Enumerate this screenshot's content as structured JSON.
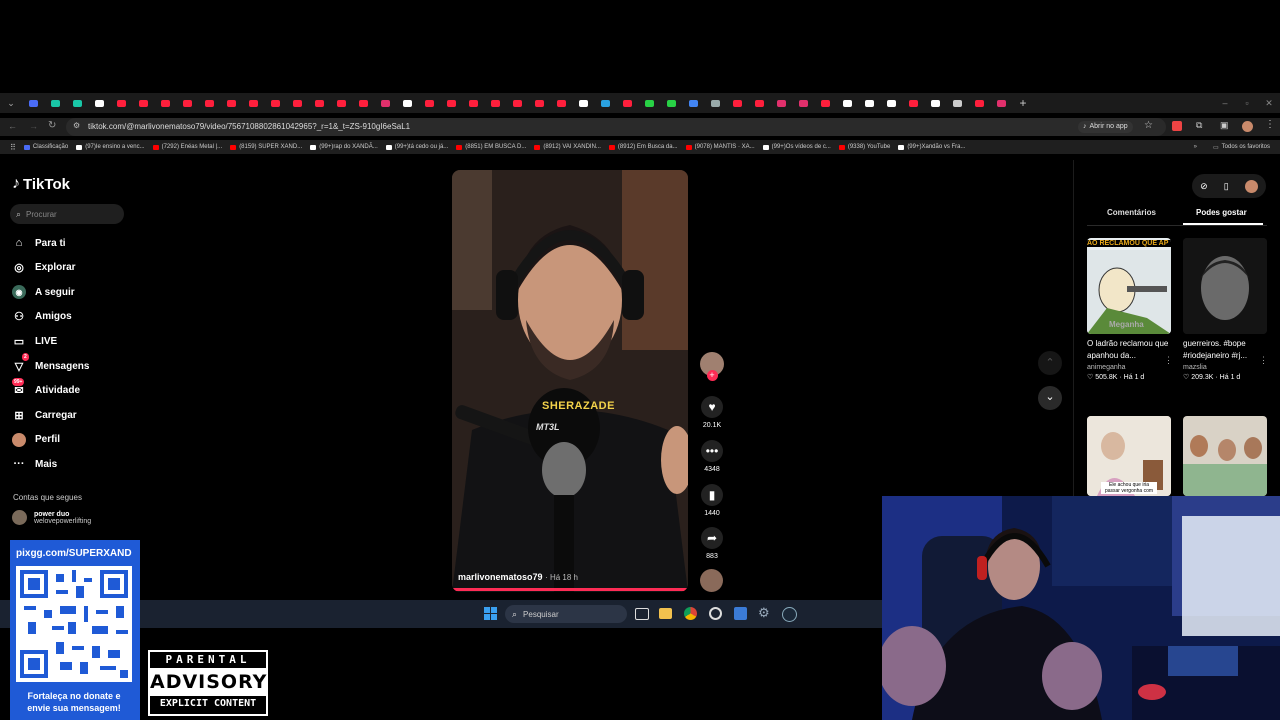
{
  "browser": {
    "url": "tiktok.com/@marlivonematoso79/video/7567108802861042965?_r=1&_t=ZS-910gI6eSaL1",
    "open_app": "Abrir no app",
    "all_favorites": "Todos os favoritos",
    "bookmarks": [
      {
        "label": "Classificação",
        "color": "#4a6cf7"
      },
      {
        "label": "(97)Ie ensino a venc...",
        "color": "#ffffff"
      },
      {
        "label": "(7292) Enéas Metal |...",
        "color": "#ff0000"
      },
      {
        "label": "(8159) SUPER XAND...",
        "color": "#ff0000"
      },
      {
        "label": "(99+)rap do XANDÃ...",
        "color": "#ffffff"
      },
      {
        "label": "(99+)tá cedo ou já...",
        "color": "#ffffff"
      },
      {
        "label": "(8851) EM BUSCA D...",
        "color": "#ff0000"
      },
      {
        "label": "(8912) VAI XANDIN...",
        "color": "#ff0000"
      },
      {
        "label": "(8912) Em Busca da...",
        "color": "#ff0000"
      },
      {
        "label": "(9078) MANTIS · XA...",
        "color": "#ff0000"
      },
      {
        "label": "(99+)Os vídeos de c...",
        "color": "#ffffff"
      },
      {
        "label": "(9338) YouTube",
        "color": "#ff0000"
      },
      {
        "label": "(99+)Xandão vs Fra...",
        "color": "#ffffff"
      }
    ]
  },
  "tiktok": {
    "logo": "TikTok",
    "search_placeholder": "Procurar",
    "nav": [
      {
        "label": "Para ti",
        "icon": "home-icon"
      },
      {
        "label": "Explorar",
        "icon": "compass-icon"
      },
      {
        "label": "A seguir",
        "icon": "following-icon"
      },
      {
        "label": "Amigos",
        "icon": "friends-icon"
      },
      {
        "label": "LIVE",
        "icon": "live-icon"
      },
      {
        "label": "Mensagens",
        "icon": "messages-icon"
      },
      {
        "label": "Atividade",
        "icon": "activity-icon"
      },
      {
        "label": "Carregar",
        "icon": "upload-icon"
      },
      {
        "label": "Perfil",
        "icon": "profile-icon"
      },
      {
        "label": "Mais",
        "icon": "more-icon"
      }
    ],
    "messages_badge": "2",
    "activity_badge": "99+",
    "following_heading": "Contas que segues",
    "following": [
      {
        "name": "power duo",
        "handle": "welovepowerlifting"
      }
    ],
    "video": {
      "author": "marlivonematoso79",
      "time": "· Há 18 h",
      "overlay_text": "SHERAZADE",
      "mic_text": "MT3L",
      "likes": "20.1K",
      "comments": "4348",
      "saves": "1440",
      "shares": "883"
    },
    "right_panel": {
      "tabs": [
        "Comentários",
        "Podes gostar"
      ],
      "cards": [
        {
          "title": "O ladrão reclamou que apanhou da...",
          "author": "animeganha",
          "views": "505.8K",
          "age": "Há 1 d",
          "thumb_text": "ÃO RECLAMOU QUE AP",
          "watermark": "Meganha"
        },
        {
          "title": "guerreiros. #bope #riodejaneiro #rj...",
          "author": "mazslia",
          "views": "209.3K",
          "age": "Há 1 d"
        },
        {
          "caption": "Ele achou que iria passar vergonha com"
        },
        {}
      ]
    }
  },
  "taskbar": {
    "search_label": "Pesquisar"
  },
  "overlay": {
    "donate_url": "pixgg.com/SUPERXAND",
    "donate_text": "Fortaleça no donate e envie sua mensagem!",
    "parental": "PARENTAL",
    "advisory": "ADVISORY",
    "explicit": "EXPLICIT CONTENT"
  }
}
